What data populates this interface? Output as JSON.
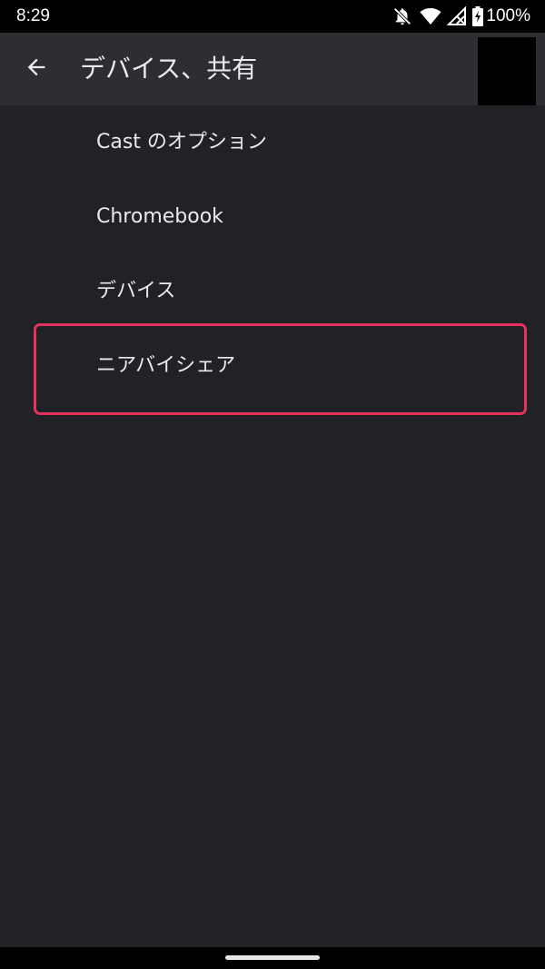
{
  "status_bar": {
    "time": "8:29",
    "battery_percent": "100%",
    "icons": [
      "notifications-off-icon",
      "wifi-icon",
      "signal-no-data-icon",
      "battery-charging-icon"
    ]
  },
  "app_bar": {
    "back_icon": "arrow-back-icon",
    "title": "デバイス、共有"
  },
  "list": {
    "items": [
      {
        "label": "Cast のオプション"
      },
      {
        "label": "Chromebook"
      },
      {
        "label": "デバイス"
      },
      {
        "label": "ニアバイシェア",
        "highlighted": true
      }
    ]
  },
  "colors": {
    "background": "#212226",
    "app_bar": "#2d2e32",
    "text": "#e8eaed",
    "highlight": "#e8305f",
    "status_bar": "#000000"
  }
}
